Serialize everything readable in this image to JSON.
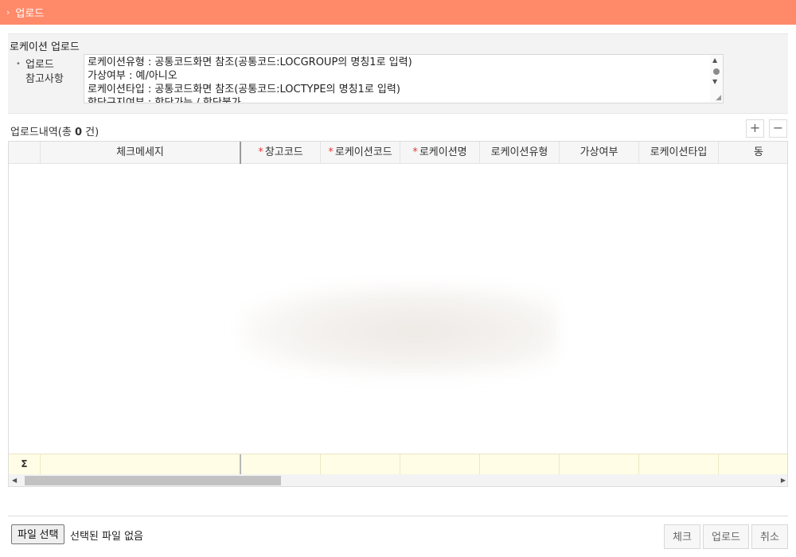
{
  "titlebar": {
    "title": "업로드"
  },
  "notice": {
    "section_title": "로케이션 업로드",
    "label_line1": "업로드",
    "label_line2": "참고사항",
    "lines": [
      "로케이션유형 : 공통코드화면 참조(공통코드:LOCGROUP의 명칭1로 입력)",
      "가상여부 : 예/아니오",
      "로케이션타입 : 공통코드화면 참조(공통코드:LOCTYPE의 명칭1로 입력)",
      "합단구지여부 : 합단가능 / 합단불가"
    ]
  },
  "grid": {
    "count_label": "업로드내역(총 ",
    "count_value": "0",
    "count_suffix": " 건)",
    "add_icon": "plus-icon",
    "remove_icon": "minus-icon",
    "columns": [
      {
        "label": "체크메세지",
        "required": false
      },
      {
        "label": "창고코드",
        "required": true
      },
      {
        "label": "로케이션코드",
        "required": true
      },
      {
        "label": "로케이션명",
        "required": true
      },
      {
        "label": "로케이션유형",
        "required": false
      },
      {
        "label": "가상여부",
        "required": false
      },
      {
        "label": "로케이션타입",
        "required": false
      },
      {
        "label": "동",
        "required": false
      }
    ],
    "required_marker": "*",
    "sum_symbol": "Σ",
    "rows": []
  },
  "footer": {
    "file_button": "파일 선택",
    "file_status": "선택된 파일 없음",
    "check_button": "체크",
    "upload_button": "업로드",
    "cancel_button": "취소"
  },
  "colors": {
    "title_bar": "#ff8a6a",
    "required": "#e23a3a",
    "sum_row": "#fffde6"
  }
}
